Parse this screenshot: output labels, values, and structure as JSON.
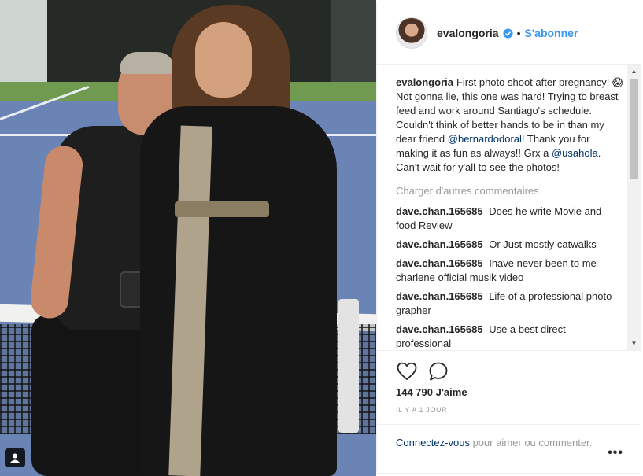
{
  "post": {
    "username": "evalongoria",
    "verified_icon": "verified-badge-icon",
    "follow_label": "S'abonner",
    "separator": "•"
  },
  "caption": {
    "username": "evalongoria",
    "text_1": "First photo shoot after pregnancy! 😱  Not gonna lie, this one was hard! Trying to breast feed and work around Santiago's schedule. Couldn't think of better hands to be in than my dear friend ",
    "mention_1": "@bernardodoral",
    "text_2": "! Thank you for making it as fun as always!! Grx a ",
    "mention_2": "@usahola",
    "text_3": ". Can't wait for y'all to see the photos!"
  },
  "load_more_label": "Charger d'autres commentaires",
  "comments": [
    {
      "username": "dave.chan.165685",
      "text": "Does he write Movie and food Review"
    },
    {
      "username": "dave.chan.165685",
      "text": "Or Just mostly catwalks"
    },
    {
      "username": "dave.chan.165685",
      "text": "Ihave never been to me charlene official musik video"
    },
    {
      "username": "dave.chan.165685",
      "text": "Life of a professional photo grapher"
    },
    {
      "username": "dave.chan.165685",
      "text": "Use a best direct professional"
    }
  ],
  "likes_label": "144 790 J'aime",
  "time_label": "IL Y A 1 JOUR",
  "login_prompt": {
    "link": "Connectez-vous",
    "rest": " pour aimer ou commenter."
  },
  "more_label": "•••",
  "icons": {
    "like": "heart-icon",
    "comment": "comment-bubble-icon",
    "tag": "user-tag-icon",
    "options": "more-options-icon"
  },
  "colors": {
    "link": "#3897f0",
    "mention": "#003569",
    "muted": "#999999"
  }
}
